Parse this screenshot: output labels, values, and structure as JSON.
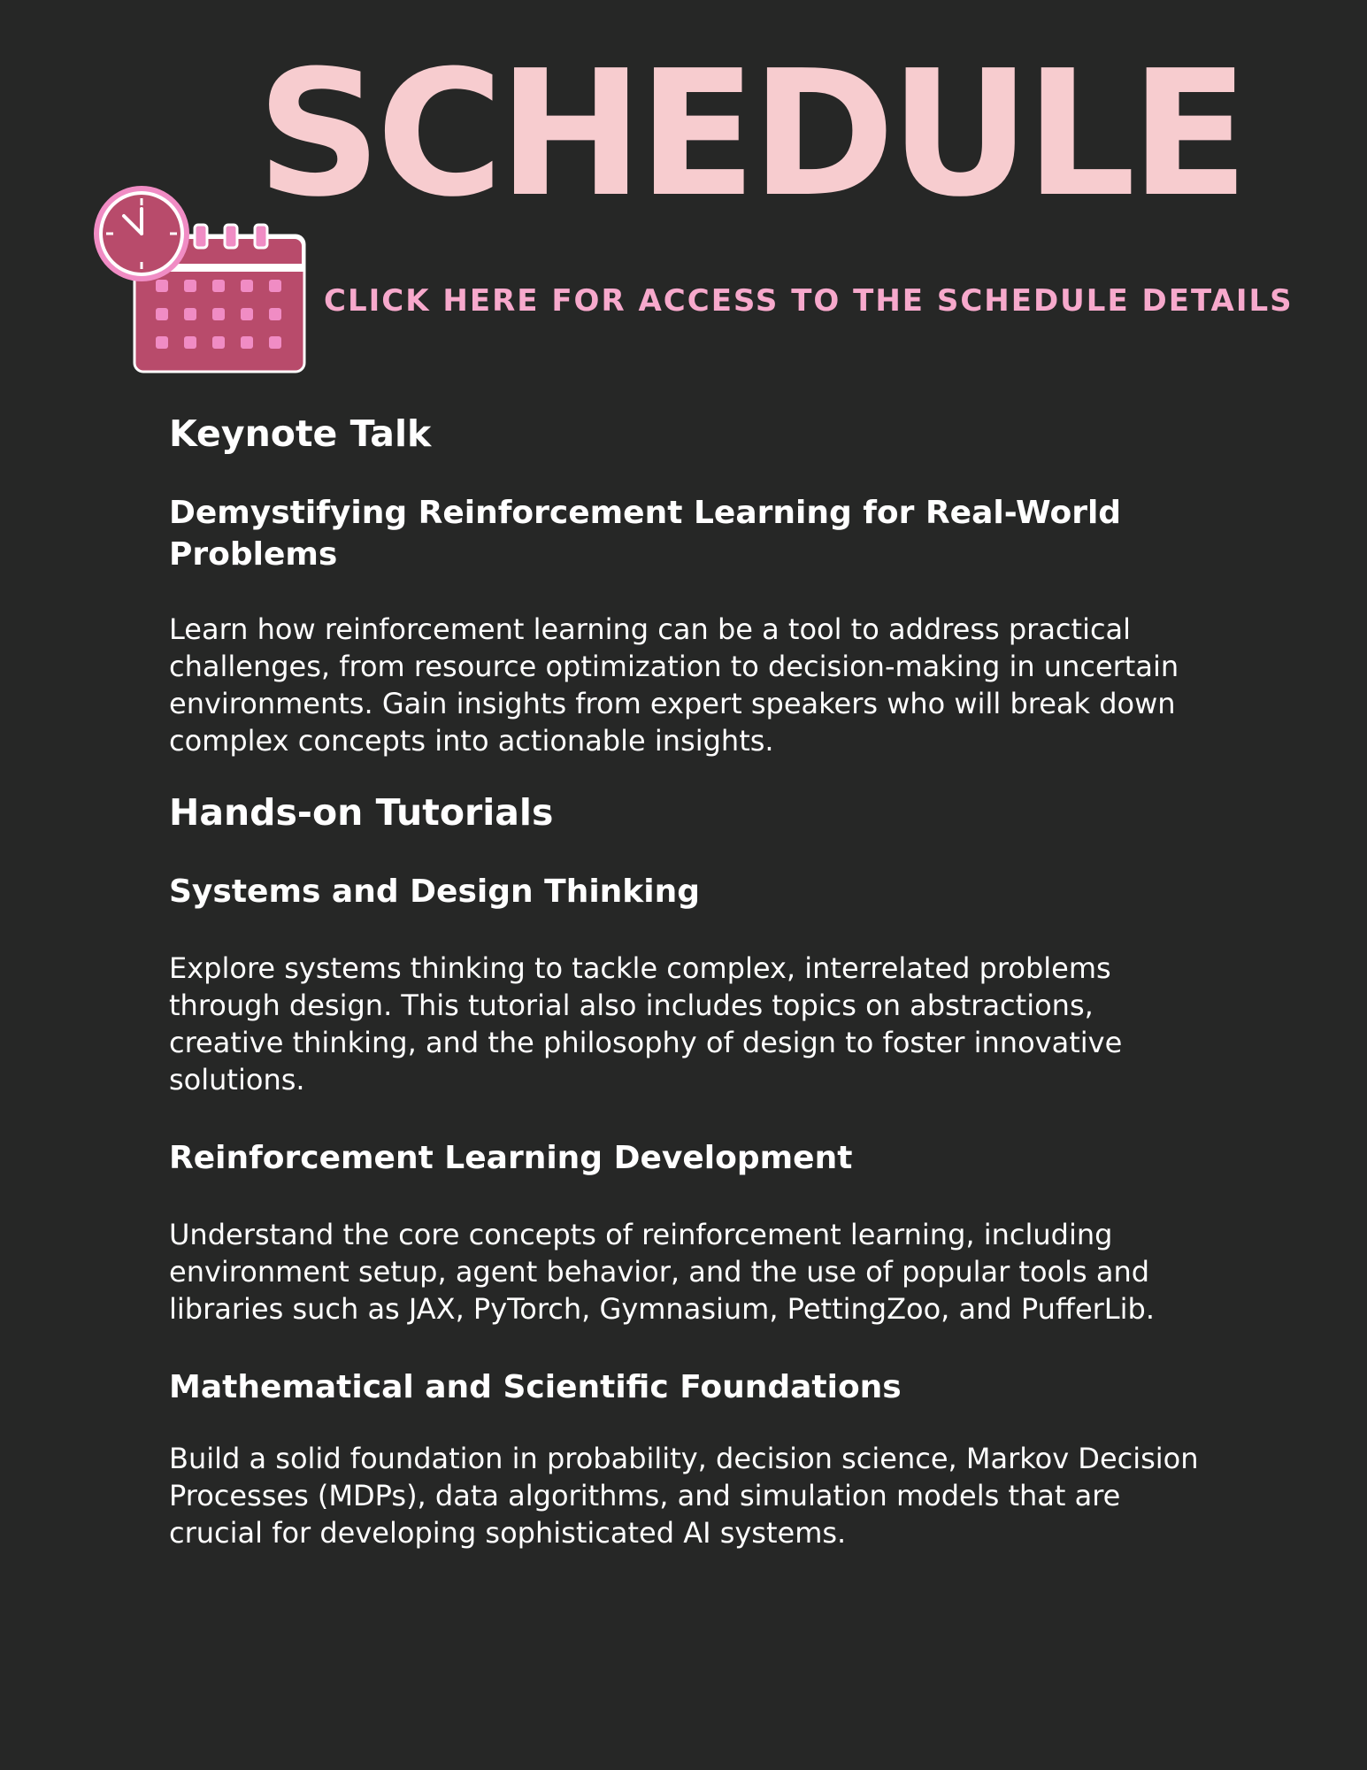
{
  "header": {
    "title": "SCHEDULE",
    "cta_link": "CLICK HERE FOR ACCESS TO THE SCHEDULE DETAILS",
    "icon": "calendar-clock-icon"
  },
  "colors": {
    "background": "#262726",
    "title": "#f7cccf",
    "cta": "#f7a9cc",
    "icon_primary": "#b84b6b",
    "icon_accent": "#f08cc4",
    "text": "#ffffff"
  },
  "sections": [
    {
      "heading": "Keynote Talk",
      "items": [
        {
          "title": "Demystifying Reinforcement Learning for Real-World Problems",
          "description": "Learn how reinforcement learning can be a tool to address practical challenges, from resource optimization to decision-making in uncertain environments. Gain insights from expert speakers who will break down complex concepts into actionable insights."
        }
      ]
    },
    {
      "heading": "Hands-on Tutorials",
      "items": [
        {
          "title": "Systems and Design Thinking",
          "description": "Explore systems thinking to tackle complex, interrelated problems through design. This tutorial also includes topics on abstractions, creative thinking, and the philosophy of design to foster innovative solutions."
        },
        {
          "title": "Reinforcement Learning Development",
          "description": "Understand the core concepts of reinforcement learning, including environment setup, agent behavior, and the use of popular tools and libraries such as JAX, PyTorch, Gymnasium, PettingZoo, and PufferLib."
        },
        {
          "title": "Mathematical and Scientific Foundations",
          "description": "Build a solid foundation in probability, decision science, Markov Decision Processes (MDPs), data algorithms, and simulation models that are crucial for developing sophisticated AI systems."
        }
      ]
    }
  ]
}
